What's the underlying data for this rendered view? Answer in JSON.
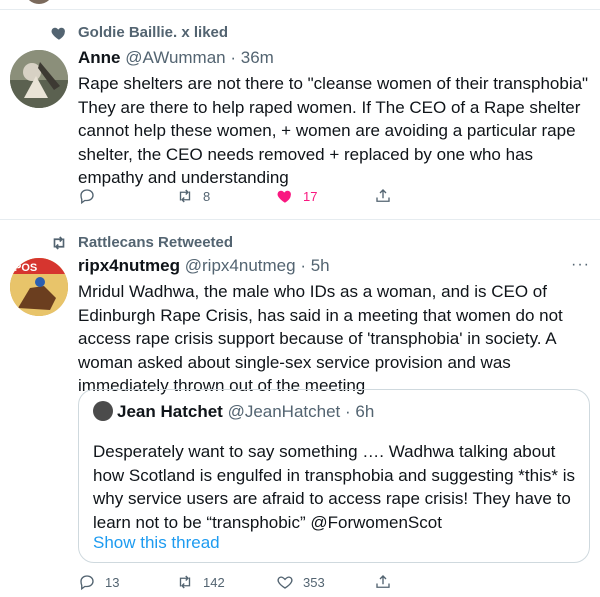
{
  "tweet1": {
    "social_text": "Goldie Baillie. x liked",
    "author_name": "Anne",
    "handle": "@AWumman",
    "dot": "·",
    "time": "36m",
    "text": "Rape shelters are not there to \"cleanse women of their transphobia\" They are there to help raped women. If The CEO of a Rape shelter cannot help these women, + women are avoiding a particular rape shelter, the CEO needs removed + replaced by one who has empathy and understanding",
    "actions": {
      "replies": "",
      "retweets": "8",
      "likes": "17",
      "share": ""
    },
    "liked_color": "#f91880"
  },
  "tweet2": {
    "social_text": "Rattlecans Retweeted",
    "author_name": "ripx4nutmeg",
    "handle": "@ripx4nutmeg",
    "dot": "·",
    "time": "5h",
    "more": "···",
    "text": "Mridul Wadhwa, the male who IDs as a woman, and is CEO of Edinburgh Rape Crisis, has said in a meeting that women do not access rape crisis support because of 'transphobia' in society. A woman asked about single-sex service provision and was immediately thrown out of the meeting",
    "quote": {
      "author_name": "Jean Hatchet",
      "handle": "@JeanHatchet",
      "dot": "·",
      "time": "6h",
      "text": "Desperately want to say something …. Wadhwa talking about how Scotland is engulfed in transphobia and suggesting *this* is why service users are afraid to access rape crisis! They have to learn not to be “transphobic” @ForwomenScot",
      "show_thread": "Show this thread"
    },
    "actions": {
      "replies": "13",
      "retweets": "142",
      "likes": "353",
      "share": ""
    }
  },
  "colors": {
    "secondary_text": "#536471",
    "link": "#1d9bf0",
    "divider": "#e6ecf0"
  }
}
